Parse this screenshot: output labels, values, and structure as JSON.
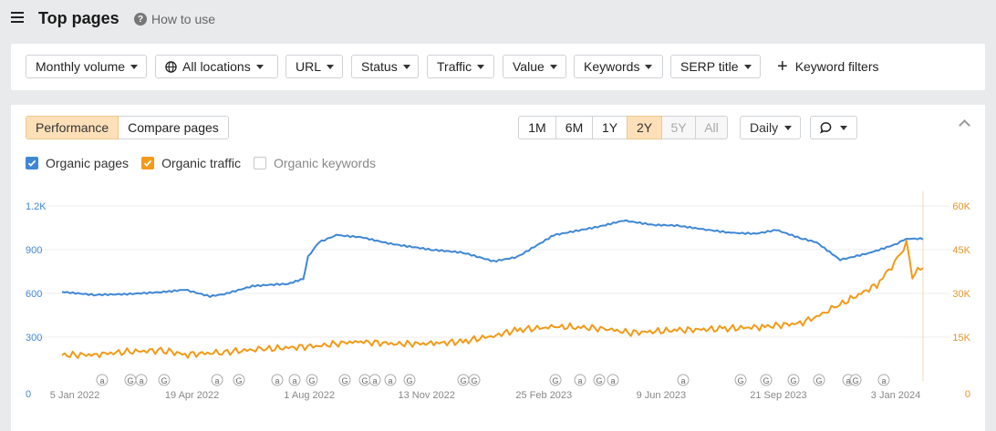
{
  "header": {
    "title": "Top pages",
    "help_label": "How to use"
  },
  "filters": [
    {
      "label": "Monthly volume",
      "icon": ""
    },
    {
      "label": "All locations",
      "icon": "globe-icon"
    },
    {
      "label": "URL",
      "icon": ""
    },
    {
      "label": "Status",
      "icon": ""
    },
    {
      "label": "Traffic",
      "icon": ""
    },
    {
      "label": "Value",
      "icon": ""
    },
    {
      "label": "Keywords",
      "icon": ""
    },
    {
      "label": "SERP title",
      "icon": ""
    }
  ],
  "keyword_filters_label": "Keyword filters",
  "view_tabs": [
    "Performance",
    "Compare pages"
  ],
  "active_view": "Performance",
  "ranges": [
    "1M",
    "6M",
    "1Y",
    "2Y",
    "5Y",
    "All"
  ],
  "active_range": "2Y",
  "disabled_ranges": [
    "5Y",
    "All"
  ],
  "interval_label": "Daily",
  "annotation_icon": "comment-icon",
  "legend": [
    {
      "label": "Organic pages",
      "checked": true,
      "color": "#3f87d5"
    },
    {
      "label": "Organic traffic",
      "checked": true,
      "color": "#f29a19"
    },
    {
      "label": "Organic keywords",
      "checked": false,
      "color": "#999999"
    }
  ],
  "chart_data": {
    "type": "line",
    "x_labels": [
      "5 Jan 2022",
      "19 Apr 2022",
      "1 Aug 2022",
      "13 Nov 2022",
      "25 Feb 2023",
      "9 Jun 2023",
      "21 Sep 2023",
      "3 Jan 2024"
    ],
    "y_left_ticks": [
      "0",
      "300",
      "600",
      "900",
      "1.2K"
    ],
    "y_right_ticks": [
      "0",
      "15K",
      "30K",
      "45K",
      "60K"
    ],
    "ylim_left": [
      0,
      1200
    ],
    "ylim_right": [
      0,
      60000
    ],
    "grid": true,
    "series": [
      {
        "name": "Organic pages",
        "axis": "left",
        "color": "#3f87d5",
        "x": [
          "2022-01-05",
          "2022-02-01",
          "2022-03-01",
          "2022-04-01",
          "2022-04-19",
          "2022-05-10",
          "2022-05-22",
          "2022-06-15",
          "2022-07-01",
          "2022-07-15",
          "2022-07-28",
          "2022-08-01",
          "2022-08-10",
          "2022-08-25",
          "2022-09-15",
          "2022-10-10",
          "2022-11-13",
          "2022-12-10",
          "2023-01-05",
          "2023-01-25",
          "2023-02-25",
          "2023-03-20",
          "2023-04-05",
          "2023-04-25",
          "2023-05-20",
          "2023-06-09",
          "2023-07-01",
          "2023-07-25",
          "2023-08-15",
          "2023-09-01",
          "2023-09-21",
          "2023-10-05",
          "2023-10-25",
          "2023-11-20",
          "2023-12-10",
          "2023-12-20",
          "2024-01-03"
        ],
        "y": [
          610,
          590,
          595,
          610,
          625,
          580,
          595,
          650,
          660,
          665,
          700,
          850,
          950,
          1000,
          985,
          940,
          900,
          880,
          820,
          850,
          1000,
          1035,
          1060,
          1100,
          1070,
          1065,
          1040,
          1015,
          1010,
          1035,
          980,
          950,
          830,
          880,
          935,
          975,
          975
        ]
      },
      {
        "name": "Organic traffic",
        "axis": "right",
        "color": "#f29a19",
        "x": [
          "2022-01-05",
          "2022-02-01",
          "2022-03-01",
          "2022-04-01",
          "2022-04-19",
          "2022-05-20",
          "2022-06-20",
          "2022-07-20",
          "2022-08-10",
          "2022-09-10",
          "2022-10-15",
          "2022-11-13",
          "2022-12-10",
          "2023-01-05",
          "2023-01-25",
          "2023-02-25",
          "2023-03-15",
          "2023-04-10",
          "2023-05-01",
          "2023-06-09",
          "2023-07-15",
          "2023-08-20",
          "2023-09-21",
          "2023-10-05",
          "2023-10-20",
          "2023-11-05",
          "2023-11-25",
          "2023-12-10",
          "2023-12-20",
          "2023-12-25",
          "2024-01-03"
        ],
        "y": [
          8800,
          9000,
          10000,
          10500,
          9000,
          9800,
          10800,
          11500,
          12000,
          13500,
          12700,
          12800,
          13500,
          15500,
          17500,
          18500,
          18500,
          17800,
          16500,
          17400,
          17800,
          18500,
          19800,
          22000,
          25200,
          28500,
          33000,
          40500,
          47000,
          36000,
          39500
        ]
      }
    ],
    "annotation_markers": [
      "a",
      "G",
      "a",
      "G",
      "a",
      "G",
      "a",
      "a",
      "G",
      "G",
      "G",
      "a",
      "a",
      "G",
      "G",
      "G",
      "G",
      "a",
      "G",
      "a",
      "a",
      "G",
      "G",
      "G",
      "G",
      "a",
      "G",
      "a"
    ]
  }
}
